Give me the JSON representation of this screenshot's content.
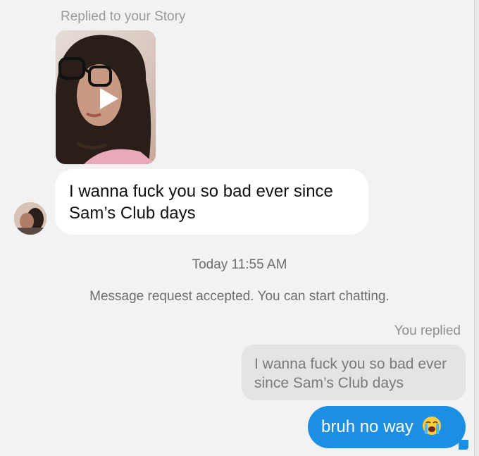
{
  "story_reply": {
    "caption": "Replied to your Story"
  },
  "incoming_message": {
    "text": "I wanna fuck you so bad ever since Sam’s Club days"
  },
  "timestamp": "Today 11:55 AM",
  "system_message": "Message request accepted. You can start chatting.",
  "reply_context": {
    "label": "You replied",
    "quoted_text": "I wanna fuck you so bad ever since Sam’s Club days"
  },
  "outgoing_message": {
    "text": "bruh no way",
    "emoji": "loudly-crying-face-icon",
    "bubble_color": "#1a8fe3"
  },
  "colors": {
    "background": "#f2f2f2",
    "incoming_bubble": "#ffffff",
    "quoted_bubble": "#e4e4e4",
    "outgoing_bubble": "#1a8fe3"
  }
}
